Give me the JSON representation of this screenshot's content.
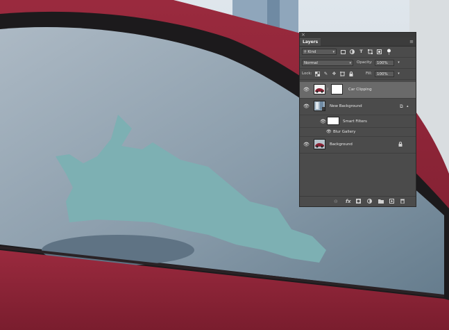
{
  "panel": {
    "tab_label": "Layers",
    "close_glyph": "×",
    "menu_glyph": "≡",
    "filter": {
      "value": "Kind",
      "search_icon": "search-icon"
    },
    "blend_mode": {
      "value": "Normal"
    },
    "opacity": {
      "label": "Opacity:",
      "value": "100%"
    },
    "lock": {
      "label": "Lock:"
    },
    "fill": {
      "label": "Fill:",
      "value": "100%"
    },
    "layers": [
      {
        "name": "Car Clipping",
        "visible": true,
        "selected": true
      },
      {
        "name": "New Background",
        "visible": true,
        "selected": false
      },
      {
        "name": "Smart Filters",
        "visible": true,
        "selected": false
      },
      {
        "name": "Blur Gallery",
        "visible": true,
        "selected": false
      },
      {
        "name": "Background",
        "visible": true,
        "selected": false
      }
    ],
    "bottom_glyphs": {
      "link": "⊖",
      "fx": "fx"
    }
  },
  "colors": {
    "car_body": "#8a2234",
    "window_sky": "#b8c8d6",
    "cyan_shape": "#7fb0b4",
    "panel_bg": "#4b4b4b",
    "selected_row": "#6a6a6a"
  }
}
